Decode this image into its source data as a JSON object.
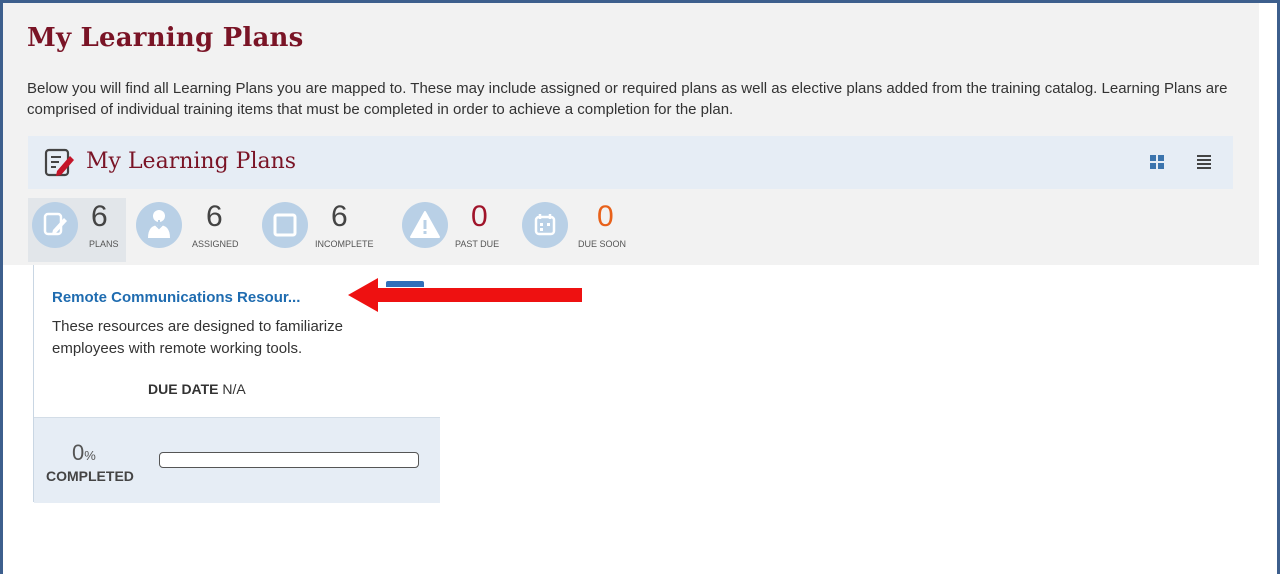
{
  "page": {
    "title": "My Learning Plans",
    "intro": "Below you will find all Learning Plans you are mapped to. These may include assigned or required plans as well as elective plans added from the training catalog. Learning Plans are comprised of individual training items that must be completed in order to achieve a completion for the plan."
  },
  "section": {
    "title": "My Learning Plans",
    "icon": "edit-document-icon",
    "view_options": [
      "grid-view-icon",
      "list-view-icon"
    ]
  },
  "stats": [
    {
      "value": "6",
      "label": "PLANS",
      "icon": "edit-document-icon",
      "color": "#444444"
    },
    {
      "value": "6",
      "label": "ASSIGNED",
      "icon": "person-assigned-icon",
      "color": "#444444"
    },
    {
      "value": "6",
      "label": "INCOMPLETE",
      "icon": "incomplete-square-icon",
      "color": "#444444"
    },
    {
      "value": "0",
      "label": "PAST DUE",
      "icon": "warning-icon",
      "color": "#a0142a"
    },
    {
      "value": "0",
      "label": "DUE SOON",
      "icon": "calendar-icon",
      "color": "#e8611a"
    }
  ],
  "plan": {
    "title": "Remote Communications Resour...",
    "description": "These resources are designed to familiarize employees with remote working tools.",
    "due_label": "DUE DATE",
    "due_value": "N/A",
    "percent": "0",
    "percent_symbol": "%",
    "completed_label": "COMPLETED",
    "progress_fraction": 0
  },
  "colors": {
    "title": "#7a1426",
    "link": "#1f6cb0",
    "accent": "#2f6fba",
    "annotation_arrow": "#ee1111"
  }
}
